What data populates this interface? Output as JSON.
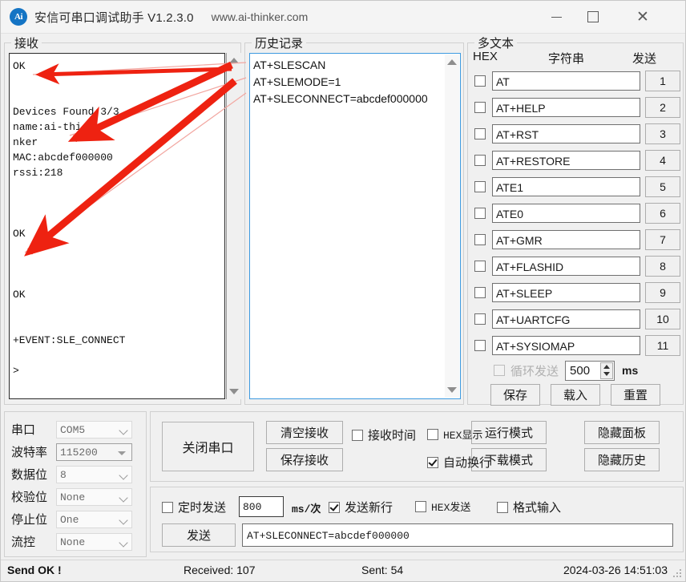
{
  "window": {
    "icon_text": "Ai",
    "title": "安信可串口调试助手 V1.2.3.0",
    "url": "www.ai-thinker.com",
    "minimize": "—",
    "maximize": "□",
    "close": "✕"
  },
  "receive": {
    "group_label": "接收",
    "content": "OK\n\n\nDevices Found:3/3\nname:ai-thi\nnker\nMAC:abcdef000000\nrssi:218\n\n\n\nOK\n\n\n\nOK\n\n\n+EVENT:SLE_CONNECT\n\n>"
  },
  "history": {
    "group_label": "历史记录",
    "lines": "AT+SLESCAN\nAT+SLEMODE=1\nAT+SLECONNECT=abcdef000000"
  },
  "multitext": {
    "group_label": "多文本",
    "header_hex": "HEX",
    "header_string": "字符串",
    "header_send": "发送",
    "rows": [
      {
        "checked": false,
        "value": "AT",
        "button": "1"
      },
      {
        "checked": false,
        "value": "AT+HELP",
        "button": "2"
      },
      {
        "checked": false,
        "value": "AT+RST",
        "button": "3"
      },
      {
        "checked": false,
        "value": "AT+RESTORE",
        "button": "4"
      },
      {
        "checked": false,
        "value": "ATE1",
        "button": "5"
      },
      {
        "checked": false,
        "value": "ATE0",
        "button": "6"
      },
      {
        "checked": false,
        "value": "AT+GMR",
        "button": "7"
      },
      {
        "checked": false,
        "value": "AT+FLASHID",
        "button": "8"
      },
      {
        "checked": false,
        "value": "AT+SLEEP",
        "button": "9"
      },
      {
        "checked": false,
        "value": "AT+UARTCFG",
        "button": "10"
      },
      {
        "checked": false,
        "value": "AT+SYSIOMAP",
        "button": "11"
      }
    ],
    "cycle_label": "循环发送",
    "cycle_value": "500",
    "cycle_unit": "ms",
    "save_label": "保存",
    "load_label": "载入",
    "reset_label": "重置"
  },
  "serial": {
    "rows": [
      {
        "label": "串口",
        "value": "COM5",
        "style": "normal"
      },
      {
        "label": "波特率",
        "value": "115200",
        "style": "focused"
      },
      {
        "label": "数据位",
        "value": "8",
        "style": "normal"
      },
      {
        "label": "校验位",
        "value": "None",
        "style": "normal"
      },
      {
        "label": "停止位",
        "value": "One",
        "style": "normal"
      },
      {
        "label": "流控",
        "value": "None",
        "style": "normal"
      }
    ]
  },
  "controls": {
    "close_port": "关闭串口",
    "clear_recv": "清空接收",
    "save_recv": "保存接收",
    "run_mode": "运行模式",
    "download_mode": "下载模式",
    "hide_panel": "隐藏面板",
    "hide_history": "隐藏历史",
    "recv_time_label": "接收时间",
    "recv_time_checked": false,
    "hex_show_label": "HEX显示",
    "hex_show_checked": false,
    "auto_wrap_label": "自动换行",
    "auto_wrap_checked": true
  },
  "send": {
    "timed_label": "定时发送",
    "timed_checked": false,
    "timed_value": "800",
    "timed_unit": "ms/次",
    "newline_label": "发送新行",
    "newline_checked": true,
    "hexsend_label": "HEX发送",
    "hexsend_checked": false,
    "fmtinput_label": "格式输入",
    "fmtinput_checked": false,
    "send_button": "发送",
    "send_value": "AT+SLECONNECT=abcdef000000"
  },
  "status": {
    "message": "Send OK !",
    "received": "Received: 107",
    "sent": "Sent: 54",
    "datetime": "2024-03-26 14:51:03"
  },
  "annotations": {
    "arrow_color": "#ee2211",
    "count": 3
  }
}
